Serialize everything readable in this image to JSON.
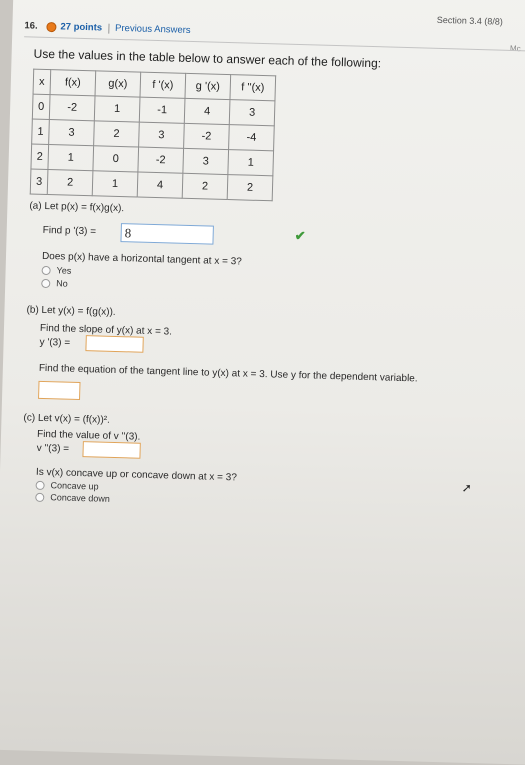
{
  "header": {
    "section": "Section 3.4 (8/8)",
    "question_number": "16.",
    "points": "27 points",
    "previous_answers": "Previous Answers",
    "corner_text": "Mc"
  },
  "intro": "Use the values in the table below to answer each of the following:",
  "table": {
    "headers": [
      "x",
      "f(x)",
      "g(x)",
      "f '(x)",
      "g '(x)",
      "f ''(x)"
    ],
    "rows": [
      [
        "0",
        "-2",
        "1",
        "-1",
        "4",
        "3"
      ],
      [
        "1",
        "3",
        "2",
        "3",
        "-2",
        "-4"
      ],
      [
        "2",
        "1",
        "0",
        "-2",
        "3",
        "1"
      ],
      [
        "3",
        "2",
        "1",
        "4",
        "2",
        "2"
      ]
    ]
  },
  "part_a": {
    "label": "(a) Let p(x) = f(x)g(x).",
    "find": "Find p '(3) =",
    "answer": "8",
    "tangent_question": "Does p(x) have a horizontal tangent at x = 3?",
    "options": [
      "Yes",
      "No"
    ]
  },
  "part_b": {
    "label": "(b) Let y(x) = f(g(x)).",
    "slope_question": "Find the slope of y(x) at x = 3.",
    "yprime": "y '(3) =",
    "tangent_eq": "Find the equation of the tangent line to y(x) at x = 3. Use y for the dependent variable."
  },
  "part_c": {
    "label": "(c) Let v(x) = (f(x))².",
    "find": "Find the value of v ''(3).",
    "vpp": "v ''(3) =",
    "concavity_question": "Is v(x) concave up or concave down at x = 3?",
    "options": [
      "Concave up",
      "Concave down"
    ]
  }
}
